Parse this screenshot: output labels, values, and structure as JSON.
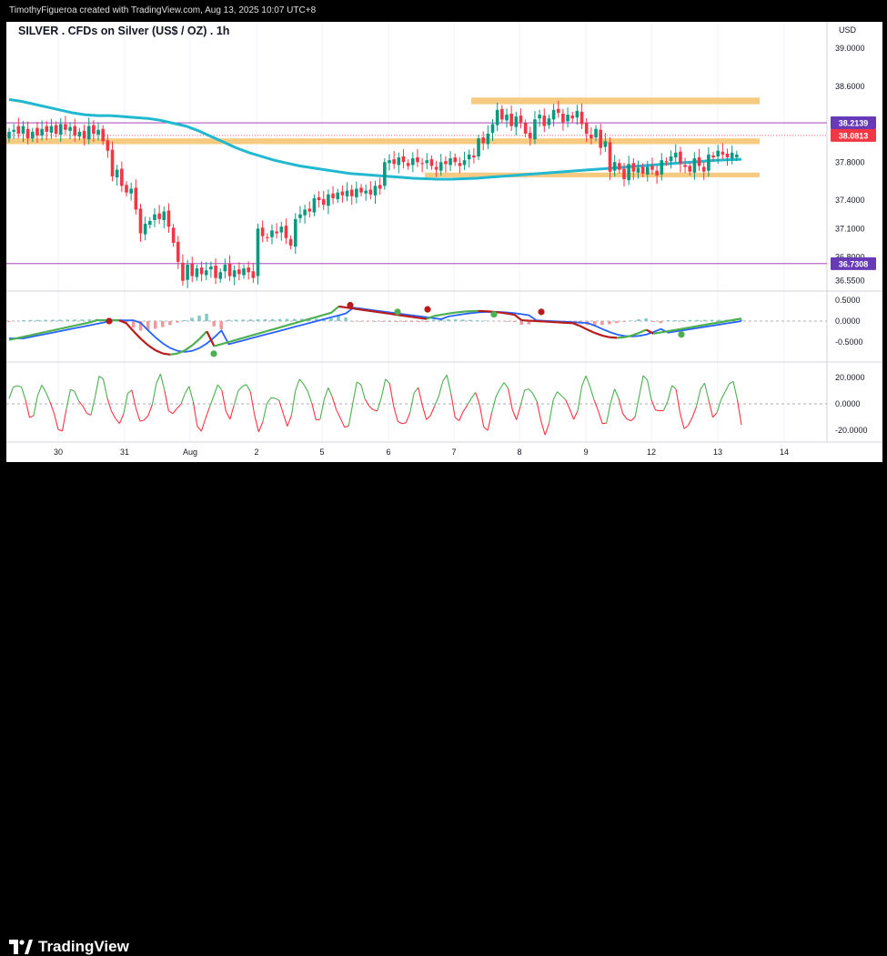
{
  "caption": "TimothyFigueroa created with TradingView.com, Aug 13, 2025 10:07 UTC+8",
  "brand": "TradingView",
  "chart_data": {
    "type": "candlestick",
    "title": "SILVER . CFDs on Silver (US$ / OZ) . 1h",
    "currency": "USD",
    "x_labels": [
      "30",
      "31",
      "Aug",
      "2",
      "5",
      "6",
      "7",
      "8",
      "9",
      "12",
      "13",
      "14"
    ],
    "price_axis_ticks": [
      "39.0000",
      "38.6000",
      "37.8000",
      "37.4000",
      "37.1000",
      "36.8000",
      "36.5500"
    ],
    "ylim": [
      36.49,
      39.15
    ],
    "price_labels": [
      {
        "value": "38.2139",
        "color": "#673ab7"
      },
      {
        "value": "38.0813",
        "color": "#f23645"
      },
      {
        "value": "36.7308",
        "color": "#673ab7"
      }
    ],
    "horizontal_lines": [
      38.2139,
      36.7308
    ],
    "zones": [
      {
        "from": 38.41,
        "to": 38.48,
        "color": "#f5c26b"
      },
      {
        "from": 37.99,
        "to": 38.05,
        "color": "#f5c26b"
      },
      {
        "from": 37.64,
        "to": 37.69,
        "color": "#f5c26b"
      }
    ],
    "close_series": [
      38.12,
      38.14,
      38.1,
      38.18,
      38.05,
      38.12,
      38.08,
      38.15,
      38.12,
      38.18,
      38.1,
      38.2,
      38.14,
      38.17,
      38.08,
      38.12,
      38.05,
      38.18,
      38.1,
      38.14,
      38.02,
      37.92,
      37.65,
      37.72,
      37.55,
      37.48,
      37.52,
      37.3,
      37.05,
      37.15,
      37.18,
      37.25,
      37.2,
      37.28,
      37.12,
      36.95,
      36.75,
      36.55,
      36.72,
      36.6,
      36.68,
      36.62,
      36.66,
      36.7,
      36.58,
      36.64,
      36.72,
      36.6,
      36.66,
      36.62,
      36.68,
      36.64,
      36.58,
      37.1,
      37.02,
      37.0,
      37.08,
      37.05,
      37.12,
      37.0,
      36.92,
      37.2,
      37.25,
      37.3,
      37.28,
      37.42,
      37.4,
      37.35,
      37.46,
      37.42,
      37.48,
      37.45,
      37.5,
      37.44,
      37.52,
      37.48,
      37.5,
      37.46,
      37.55,
      37.52,
      37.8,
      37.82,
      37.78,
      37.85,
      37.8,
      37.76,
      37.84,
      37.8,
      37.78,
      37.82,
      37.76,
      37.72,
      37.8,
      37.78,
      37.84,
      37.8,
      37.76,
      37.82,
      37.88,
      37.85,
      38.05,
      38.0,
      38.1,
      38.2,
      38.35,
      38.25,
      38.3,
      38.18,
      38.28,
      38.22,
      38.1,
      38.05,
      38.25,
      38.3,
      38.18,
      38.26,
      38.35,
      38.32,
      38.22,
      38.3,
      38.26,
      38.34,
      38.2,
      38.1,
      38.05,
      38.15,
      37.95,
      38.02,
      37.7,
      37.8,
      37.72,
      37.62,
      37.78,
      37.7,
      37.74,
      37.68,
      37.75,
      37.72,
      37.66,
      37.82,
      37.8,
      37.86,
      37.9,
      37.78,
      37.75,
      37.7,
      37.84,
      37.76,
      37.7,
      37.88,
      37.85,
      37.92,
      37.88,
      37.85,
      37.9,
      37.88,
      38.08
    ],
    "open_series": [
      38.05,
      38.12,
      38.18,
      38.1,
      38.15,
      38.05,
      38.16,
      38.08,
      38.18,
      38.11,
      38.19,
      38.09,
      38.2,
      38.13,
      38.18,
      38.07,
      38.13,
      38.04,
      38.19,
      38.09,
      38.15,
      38.03,
      37.93,
      37.64,
      37.73,
      37.56,
      37.47,
      37.53,
      37.31,
      37.04,
      37.14,
      37.19,
      37.26,
      37.19,
      37.29,
      37.11,
      36.96,
      36.74,
      36.56,
      36.73,
      36.59,
      36.69,
      36.61,
      36.67,
      36.71,
      36.57,
      36.65,
      36.73,
      36.59,
      36.67,
      36.61,
      36.69,
      36.65,
      36.6,
      37.11,
      37.01,
      37.01,
      37.07,
      37.06,
      37.13,
      36.99,
      36.91,
      37.21,
      37.24,
      37.31,
      37.27,
      37.43,
      37.41,
      37.34,
      37.47,
      37.41,
      37.49,
      37.44,
      37.51,
      37.43,
      37.53,
      37.47,
      37.51,
      37.45,
      37.56,
      37.55,
      37.79,
      37.83,
      37.77,
      37.86,
      37.79,
      37.77,
      37.85,
      37.79,
      37.79,
      37.83,
      37.75,
      37.71,
      37.81,
      37.77,
      37.85,
      37.79,
      37.77,
      37.83,
      37.87,
      37.86,
      38.06,
      37.99,
      38.11,
      38.19,
      38.36,
      38.24,
      38.31,
      38.17,
      38.29,
      38.21,
      38.11,
      38.04,
      38.26,
      38.29,
      38.19,
      38.25,
      38.36,
      38.31,
      38.23,
      38.29,
      38.27,
      38.33,
      38.21,
      38.09,
      38.06,
      38.14,
      37.96,
      38.01,
      37.71,
      37.79,
      37.73,
      37.61,
      37.79,
      37.69,
      37.75,
      37.67,
      37.76,
      37.71,
      37.67,
      37.81,
      37.81,
      37.85,
      37.91,
      37.77,
      37.76,
      37.69,
      37.85,
      37.75,
      37.71,
      37.87,
      37.86,
      37.91,
      37.89,
      37.84,
      37.85
    ],
    "ma_series": [
      38.46,
      38.44,
      38.41,
      38.38,
      38.35,
      38.32,
      38.3,
      38.29,
      38.29,
      38.28,
      38.27,
      38.26,
      38.24,
      38.21,
      38.18,
      38.13,
      38.07,
      38.01,
      37.95,
      37.9,
      37.86,
      37.82,
      37.79,
      37.76,
      37.74,
      37.72,
      37.7,
      37.68,
      37.67,
      37.66,
      37.65,
      37.64,
      37.63,
      37.625,
      37.62,
      37.62,
      37.625,
      37.63,
      37.64,
      37.65,
      37.66,
      37.67,
      37.68,
      37.69,
      37.7,
      37.71,
      37.72,
      37.73,
      37.74,
      37.75,
      37.76,
      37.77,
      37.78,
      37.79,
      37.8,
      37.81,
      37.82,
      37.825,
      37.83
    ],
    "panels": [
      {
        "name": "oscillator",
        "ticks": [
          "0.5000",
          "0.0000",
          "-0.5000"
        ]
      },
      {
        "name": "momentum",
        "ticks": [
          "20.0000",
          "0.0000",
          "-20.0000"
        ]
      }
    ]
  }
}
